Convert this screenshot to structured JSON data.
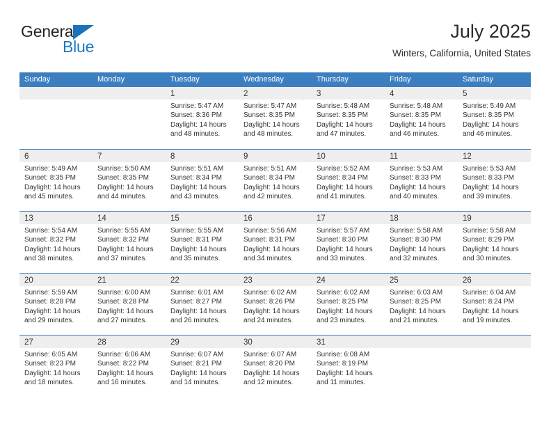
{
  "brand": {
    "name_top": "General",
    "name_bottom": "Blue",
    "triangle_color": "#1c72bb",
    "blue_text_color": "#1c79c0"
  },
  "header": {
    "title": "July 2025",
    "subtitle": "Winters, California, United States"
  },
  "theme": {
    "header_blue": "#3c7fc1",
    "day_band_gray": "#eeeeee",
    "text_color": "#333333"
  },
  "weekdays": [
    "Sunday",
    "Monday",
    "Tuesday",
    "Wednesday",
    "Thursday",
    "Friday",
    "Saturday"
  ],
  "weeks": [
    [
      {
        "day": "",
        "empty": true,
        "sunrise": "",
        "sunset": "",
        "daylight_line1": "",
        "daylight_line2": ""
      },
      {
        "day": "",
        "empty": true,
        "sunrise": "",
        "sunset": "",
        "daylight_line1": "",
        "daylight_line2": ""
      },
      {
        "day": "1",
        "sunrise": "Sunrise: 5:47 AM",
        "sunset": "Sunset: 8:36 PM",
        "daylight_line1": "Daylight: 14 hours",
        "daylight_line2": "and 48 minutes."
      },
      {
        "day": "2",
        "sunrise": "Sunrise: 5:47 AM",
        "sunset": "Sunset: 8:35 PM",
        "daylight_line1": "Daylight: 14 hours",
        "daylight_line2": "and 48 minutes."
      },
      {
        "day": "3",
        "sunrise": "Sunrise: 5:48 AM",
        "sunset": "Sunset: 8:35 PM",
        "daylight_line1": "Daylight: 14 hours",
        "daylight_line2": "and 47 minutes."
      },
      {
        "day": "4",
        "sunrise": "Sunrise: 5:48 AM",
        "sunset": "Sunset: 8:35 PM",
        "daylight_line1": "Daylight: 14 hours",
        "daylight_line2": "and 46 minutes."
      },
      {
        "day": "5",
        "sunrise": "Sunrise: 5:49 AM",
        "sunset": "Sunset: 8:35 PM",
        "daylight_line1": "Daylight: 14 hours",
        "daylight_line2": "and 46 minutes."
      }
    ],
    [
      {
        "day": "6",
        "sunrise": "Sunrise: 5:49 AM",
        "sunset": "Sunset: 8:35 PM",
        "daylight_line1": "Daylight: 14 hours",
        "daylight_line2": "and 45 minutes."
      },
      {
        "day": "7",
        "sunrise": "Sunrise: 5:50 AM",
        "sunset": "Sunset: 8:35 PM",
        "daylight_line1": "Daylight: 14 hours",
        "daylight_line2": "and 44 minutes."
      },
      {
        "day": "8",
        "sunrise": "Sunrise: 5:51 AM",
        "sunset": "Sunset: 8:34 PM",
        "daylight_line1": "Daylight: 14 hours",
        "daylight_line2": "and 43 minutes."
      },
      {
        "day": "9",
        "sunrise": "Sunrise: 5:51 AM",
        "sunset": "Sunset: 8:34 PM",
        "daylight_line1": "Daylight: 14 hours",
        "daylight_line2": "and 42 minutes."
      },
      {
        "day": "10",
        "sunrise": "Sunrise: 5:52 AM",
        "sunset": "Sunset: 8:34 PM",
        "daylight_line1": "Daylight: 14 hours",
        "daylight_line2": "and 41 minutes."
      },
      {
        "day": "11",
        "sunrise": "Sunrise: 5:53 AM",
        "sunset": "Sunset: 8:33 PM",
        "daylight_line1": "Daylight: 14 hours",
        "daylight_line2": "and 40 minutes."
      },
      {
        "day": "12",
        "sunrise": "Sunrise: 5:53 AM",
        "sunset": "Sunset: 8:33 PM",
        "daylight_line1": "Daylight: 14 hours",
        "daylight_line2": "and 39 minutes."
      }
    ],
    [
      {
        "day": "13",
        "sunrise": "Sunrise: 5:54 AM",
        "sunset": "Sunset: 8:32 PM",
        "daylight_line1": "Daylight: 14 hours",
        "daylight_line2": "and 38 minutes."
      },
      {
        "day": "14",
        "sunrise": "Sunrise: 5:55 AM",
        "sunset": "Sunset: 8:32 PM",
        "daylight_line1": "Daylight: 14 hours",
        "daylight_line2": "and 37 minutes."
      },
      {
        "day": "15",
        "sunrise": "Sunrise: 5:55 AM",
        "sunset": "Sunset: 8:31 PM",
        "daylight_line1": "Daylight: 14 hours",
        "daylight_line2": "and 35 minutes."
      },
      {
        "day": "16",
        "sunrise": "Sunrise: 5:56 AM",
        "sunset": "Sunset: 8:31 PM",
        "daylight_line1": "Daylight: 14 hours",
        "daylight_line2": "and 34 minutes."
      },
      {
        "day": "17",
        "sunrise": "Sunrise: 5:57 AM",
        "sunset": "Sunset: 8:30 PM",
        "daylight_line1": "Daylight: 14 hours",
        "daylight_line2": "and 33 minutes."
      },
      {
        "day": "18",
        "sunrise": "Sunrise: 5:58 AM",
        "sunset": "Sunset: 8:30 PM",
        "daylight_line1": "Daylight: 14 hours",
        "daylight_line2": "and 32 minutes."
      },
      {
        "day": "19",
        "sunrise": "Sunrise: 5:58 AM",
        "sunset": "Sunset: 8:29 PM",
        "daylight_line1": "Daylight: 14 hours",
        "daylight_line2": "and 30 minutes."
      }
    ],
    [
      {
        "day": "20",
        "sunrise": "Sunrise: 5:59 AM",
        "sunset": "Sunset: 8:28 PM",
        "daylight_line1": "Daylight: 14 hours",
        "daylight_line2": "and 29 minutes."
      },
      {
        "day": "21",
        "sunrise": "Sunrise: 6:00 AM",
        "sunset": "Sunset: 8:28 PM",
        "daylight_line1": "Daylight: 14 hours",
        "daylight_line2": "and 27 minutes."
      },
      {
        "day": "22",
        "sunrise": "Sunrise: 6:01 AM",
        "sunset": "Sunset: 8:27 PM",
        "daylight_line1": "Daylight: 14 hours",
        "daylight_line2": "and 26 minutes."
      },
      {
        "day": "23",
        "sunrise": "Sunrise: 6:02 AM",
        "sunset": "Sunset: 8:26 PM",
        "daylight_line1": "Daylight: 14 hours",
        "daylight_line2": "and 24 minutes."
      },
      {
        "day": "24",
        "sunrise": "Sunrise: 6:02 AM",
        "sunset": "Sunset: 8:25 PM",
        "daylight_line1": "Daylight: 14 hours",
        "daylight_line2": "and 23 minutes."
      },
      {
        "day": "25",
        "sunrise": "Sunrise: 6:03 AM",
        "sunset": "Sunset: 8:25 PM",
        "daylight_line1": "Daylight: 14 hours",
        "daylight_line2": "and 21 minutes."
      },
      {
        "day": "26",
        "sunrise": "Sunrise: 6:04 AM",
        "sunset": "Sunset: 8:24 PM",
        "daylight_line1": "Daylight: 14 hours",
        "daylight_line2": "and 19 minutes."
      }
    ],
    [
      {
        "day": "27",
        "sunrise": "Sunrise: 6:05 AM",
        "sunset": "Sunset: 8:23 PM",
        "daylight_line1": "Daylight: 14 hours",
        "daylight_line2": "and 18 minutes."
      },
      {
        "day": "28",
        "sunrise": "Sunrise: 6:06 AM",
        "sunset": "Sunset: 8:22 PM",
        "daylight_line1": "Daylight: 14 hours",
        "daylight_line2": "and 16 minutes."
      },
      {
        "day": "29",
        "sunrise": "Sunrise: 6:07 AM",
        "sunset": "Sunset: 8:21 PM",
        "daylight_line1": "Daylight: 14 hours",
        "daylight_line2": "and 14 minutes."
      },
      {
        "day": "30",
        "sunrise": "Sunrise: 6:07 AM",
        "sunset": "Sunset: 8:20 PM",
        "daylight_line1": "Daylight: 14 hours",
        "daylight_line2": "and 12 minutes."
      },
      {
        "day": "31",
        "sunrise": "Sunrise: 6:08 AM",
        "sunset": "Sunset: 8:19 PM",
        "daylight_line1": "Daylight: 14 hours",
        "daylight_line2": "and 11 minutes."
      },
      {
        "day": "",
        "empty": true,
        "sunrise": "",
        "sunset": "",
        "daylight_line1": "",
        "daylight_line2": ""
      },
      {
        "day": "",
        "empty": true,
        "sunrise": "",
        "sunset": "",
        "daylight_line1": "",
        "daylight_line2": ""
      }
    ]
  ]
}
